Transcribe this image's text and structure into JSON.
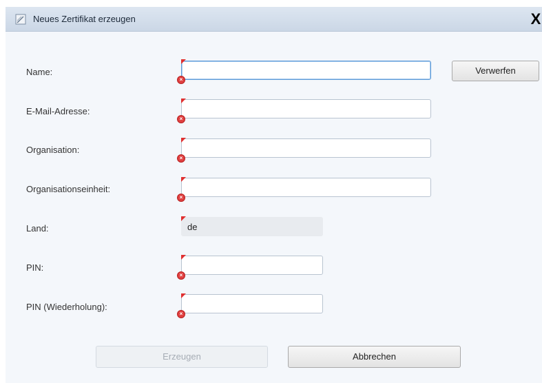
{
  "window": {
    "title": "Neues Zertifikat erzeugen",
    "close_symbol": "X",
    "icon": "certificate-icon"
  },
  "form": {
    "name_label": "Name:",
    "email_label": "E-Mail-Adresse:",
    "organisation_label": "Organisation:",
    "unit_label": "Organisationseinheit:",
    "country_label": "Land:",
    "country_value": "de",
    "pin_label": "PIN:",
    "pin_repeat_label": "PIN (Wiederholung):"
  },
  "buttons": {
    "discard": "Verwerfen",
    "create": "Erzeugen",
    "cancel": "Abbrechen"
  },
  "colors": {
    "error": "#e03030",
    "focus_border": "#5d9ad6",
    "titlebar": "#cbd7e6"
  }
}
